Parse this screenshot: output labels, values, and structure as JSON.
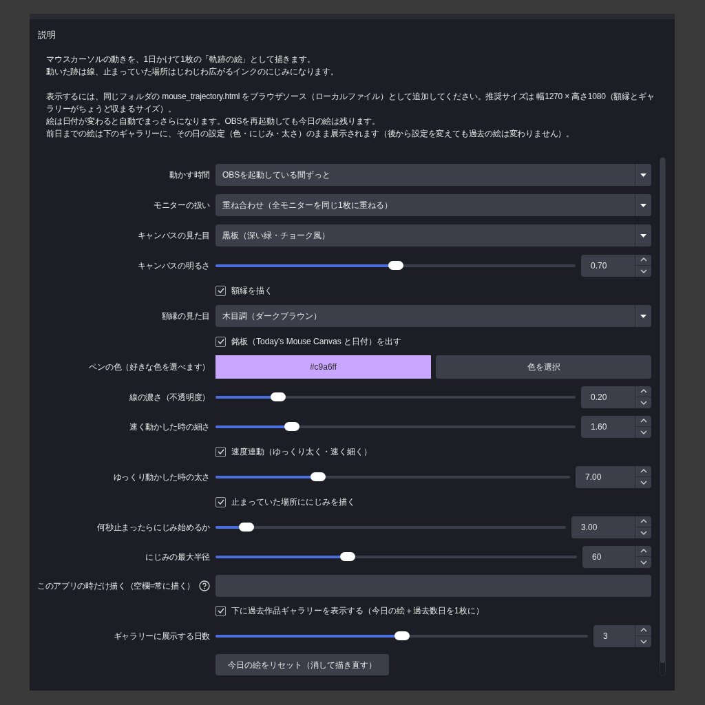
{
  "header": {
    "title": "説明"
  },
  "description": {
    "paragraphs": [
      {
        "lines": [
          "マウスカーソルの動きを、1日かけて1枚の「軌跡の絵」として描きます。",
          "動いた跡は線、止まっていた場所はじわじわ広がるインクのにじみになります。"
        ]
      },
      {
        "lines": [
          "表示するには、同じフォルダの mouse_trajectory.html をブラウザソース（ローカルファイル）として追加してください。推奨サイズは 幅1270 × 高さ1080（額縁とギャラリーがちょうど収まるサイズ）。",
          "絵は日付が変わると自動でまっさらになります。OBSを再起動しても今日の絵は残ります。",
          "前日までの絵は下のギャラリーに、その日の設定（色・にじみ・太さ）のまま展示されます（後から設定を変えても過去の絵は変わりません）。"
        ]
      }
    ]
  },
  "settings": [
    {
      "kind": "dropdown",
      "label": "動かす時間",
      "value": "OBSを起動している間ずっと"
    },
    {
      "kind": "dropdown",
      "label": "モニターの扱い",
      "value": "重ね合わせ（全モニターを同じ1枚に重ねる）"
    },
    {
      "kind": "dropdown",
      "label": "キャンバスの見た目",
      "value": "黒板（深い緑・チョーク風）"
    },
    {
      "kind": "slider",
      "label": "キャンバスの明るさ",
      "level": 0.5,
      "reading": "0.70"
    },
    {
      "kind": "checkbox",
      "label": "額縁を描く",
      "checked": true
    },
    {
      "kind": "dropdown",
      "label": "額縁の見た目",
      "value": "木目調（ダークブラウン）"
    },
    {
      "kind": "checkbox",
      "label": "銘板（Today's Mouse Canvas と日付）を出す",
      "checked": true
    },
    {
      "kind": "color",
      "label": "ペンの色（好きな色を選べます）",
      "value": "#c9a6ff",
      "color": "#c9a6ff",
      "button": "色を選択"
    },
    {
      "kind": "slider",
      "label": "線の濃さ（不透明度）",
      "level": 0.16,
      "reading": "0.20"
    },
    {
      "kind": "slider",
      "label": "速く動かした時の細さ",
      "level": 0.2,
      "reading": "1.60"
    },
    {
      "kind": "checkbox",
      "label": "速度連動（ゆっくり太く・速く細く）",
      "checked": true
    },
    {
      "kind": "slider",
      "label": "ゆっくり動かした時の太さ",
      "level": 0.28,
      "reading": "7.00"
    },
    {
      "kind": "checkbox",
      "label": "止まっていた場所ににじみを描く",
      "checked": true
    },
    {
      "kind": "slider",
      "label": "何秒止まったらにじみ始めるか",
      "level": 0.07,
      "reading": "3.00"
    },
    {
      "kind": "slider",
      "label": "にじみの最大半径",
      "level": 0.36,
      "reading": "60"
    },
    {
      "kind": "text",
      "label": "このアプリの時だけ描く（空欄=常に描く）",
      "help": true
    },
    {
      "kind": "checkbox",
      "label": "下に過去作品ギャラリーを表示する（今日の絵＋過去数日を1枚に）",
      "checked": true
    },
    {
      "kind": "slider",
      "label": "ギャラリーに展示する日数",
      "level": 0.5,
      "reading": "3"
    },
    {
      "kind": "button",
      "label": "今日の絵をリセット（消して描き直す）"
    }
  ]
}
